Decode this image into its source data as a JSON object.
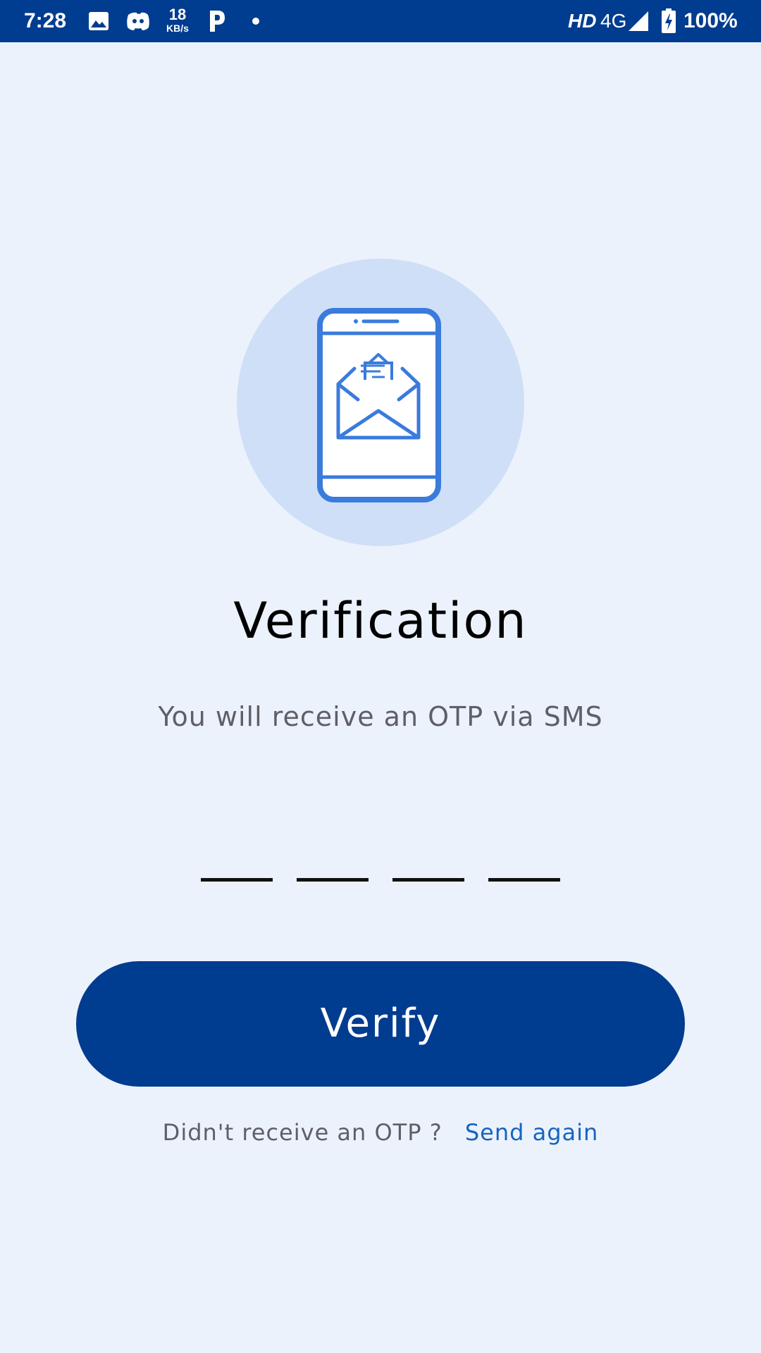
{
  "status_bar": {
    "time": "7:28",
    "net_speed_value": "18",
    "net_speed_unit": "KB/s",
    "hd_label": "HD",
    "network_type": "4G",
    "battery_percent": "100%",
    "icons": [
      "image-icon",
      "discord-icon",
      "parking-p-icon",
      "dot-icon",
      "signal-icon",
      "battery-charging-icon"
    ]
  },
  "hero": {
    "icon": "phone-envelope-icon"
  },
  "title": "Verification",
  "subtitle": "You will receive an OTP via SMS",
  "otp": {
    "digits": [
      "",
      "",
      "",
      ""
    ]
  },
  "verify_button": {
    "label": "Verify"
  },
  "resend": {
    "question": "Didn't receive an OTP ?",
    "link": "Send again"
  },
  "colors": {
    "status_bar": "#003c8f",
    "background": "#ecf2fc",
    "hero_circle": "#cfdff7",
    "hero_icon": "#3a7bdc",
    "button": "#003c8f",
    "link": "#1565c0"
  }
}
